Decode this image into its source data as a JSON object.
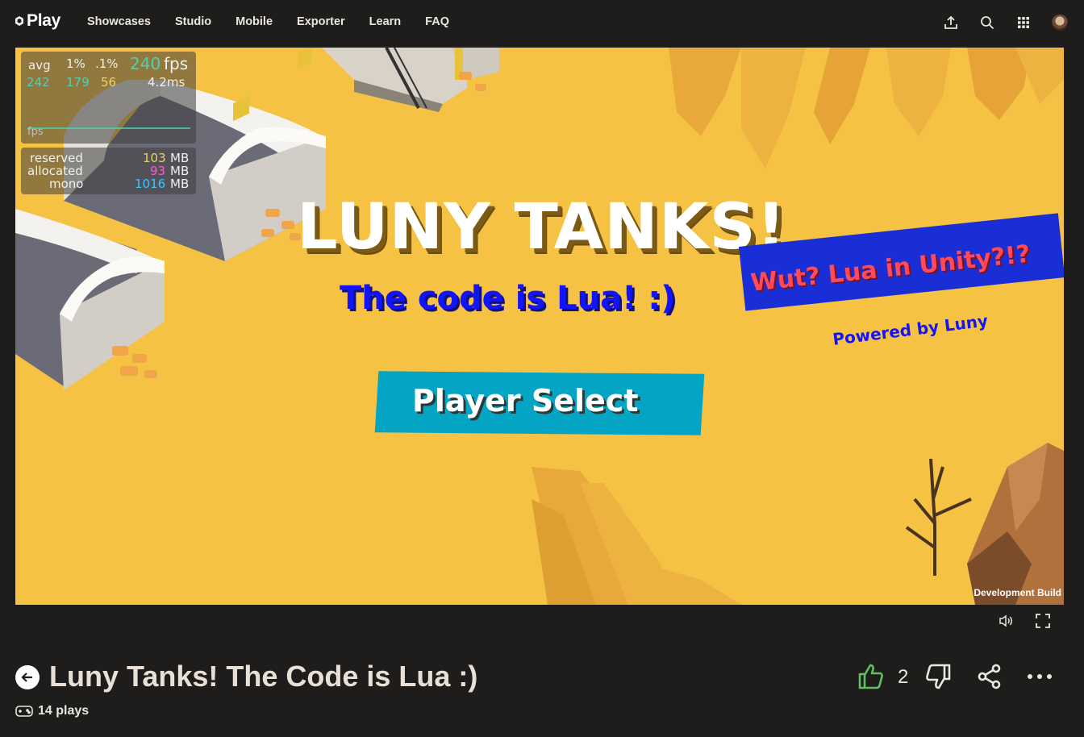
{
  "nav": {
    "logo_text": "Play",
    "links": [
      "Showcases",
      "Studio",
      "Mobile",
      "Exporter",
      "Learn",
      "FAQ"
    ],
    "icons": [
      "upload-icon",
      "search-icon",
      "apps-grid-icon",
      "user-avatar"
    ]
  },
  "stats": {
    "headers": [
      "avg",
      "1%",
      ".1%"
    ],
    "fps_value": "240",
    "fps_unit": "fps",
    "values": [
      "242",
      "179",
      "56"
    ],
    "ms": "4.2ms",
    "graph_label": "fps",
    "memory": [
      {
        "label": "reserved",
        "value": "103",
        "unit": "MB"
      },
      {
        "label": "allocated",
        "value": "93",
        "unit": "MB"
      },
      {
        "label": "mono",
        "value": "1016",
        "unit": "MB"
      }
    ]
  },
  "game": {
    "title": "LUNY TANKS!",
    "subtitle": "The code is Lua! :)",
    "wut": "Wut? Lua in Unity?!?",
    "powered": "Powered by Luny",
    "player_select": "Player Select",
    "dev_build": "Development Build"
  },
  "details": {
    "title": "Luny Tanks! The Code is Lua :)",
    "plays": "14 plays",
    "likes": "2"
  },
  "colors": {
    "background": "#1f1d1b",
    "sand": "#f6c244",
    "like_green": "#5cc05c",
    "button_teal": "#04a5c4"
  }
}
